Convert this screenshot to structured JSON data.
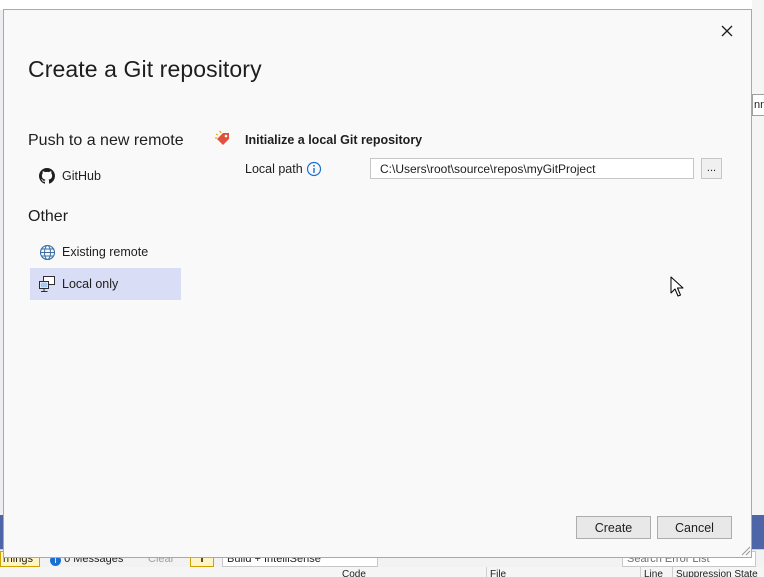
{
  "dialog": {
    "title": "Create a Git repository",
    "sidebar": {
      "push_heading": "Push to a new remote",
      "push_items": [
        {
          "label": "GitHub",
          "icon": "github-icon"
        }
      ],
      "other_heading": "Other",
      "other_items": [
        {
          "label": "Existing remote",
          "icon": "globe-icon"
        },
        {
          "label": "Local only",
          "icon": "computer-icon",
          "selected": true
        }
      ]
    },
    "main": {
      "init_label": "Initialize a local Git repository",
      "local_path_label": "Local path",
      "local_path_value": "C:\\Users\\root\\source\\repos\\myGitProject",
      "browse_label": "..."
    },
    "footer": {
      "create_label": "Create",
      "cancel_label": "Cancel"
    }
  },
  "background": {
    "right_tab_text": "nn",
    "error_list": {
      "warnings_text": "rnings",
      "messages_text": "0 Messages",
      "clear_text": "Clear",
      "filter_text": "T",
      "build_option": "Build + IntelliSense",
      "search_placeholder": "Search Error List"
    },
    "columns": [
      "Code",
      "File",
      "Line",
      "Suppression State"
    ]
  },
  "colors": {
    "selected_bg": "#d9ddf5",
    "accent_blue": "#1a6fd1",
    "git_orange": "#e2513e",
    "vs_band": "#4e66a8"
  }
}
